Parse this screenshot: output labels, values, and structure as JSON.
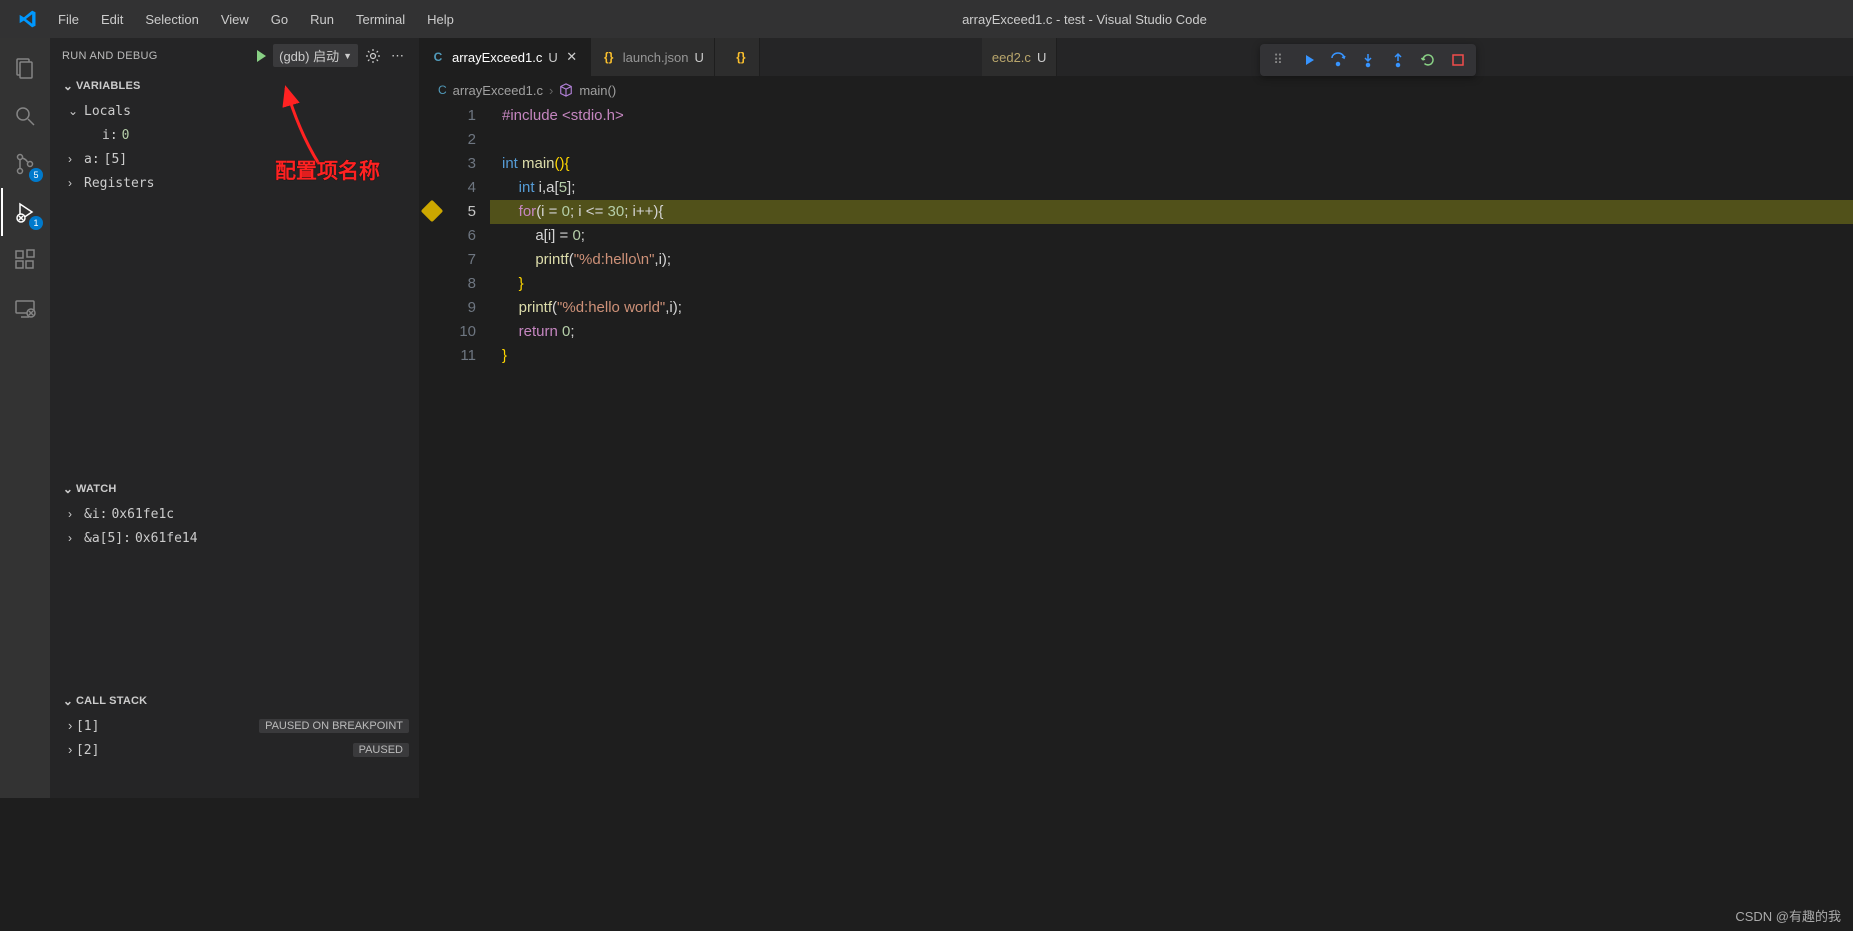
{
  "titlebar": {
    "title": "arrayExceed1.c - test - Visual Studio Code"
  },
  "menu": [
    "File",
    "Edit",
    "Selection",
    "View",
    "Go",
    "Run",
    "Terminal",
    "Help"
  ],
  "activity_badges": {
    "scm": "5",
    "debug": "1"
  },
  "sidebar": {
    "title": "RUN AND DEBUG",
    "config": "(gdb) 启动",
    "sections": {
      "variables": {
        "label": "VARIABLES",
        "locals_label": "Locals",
        "i_name": "i:",
        "i_val": "0",
        "a_name": "a:",
        "a_val": "[5]",
        "registers_label": "Registers"
      },
      "watch": {
        "label": "WATCH",
        "w1_name": "&i:",
        "w1_val": "0x61fe1c",
        "w2_name": "&a[5]:",
        "w2_val": "0x61fe14"
      },
      "callstack": {
        "label": "CALL STACK",
        "f1_name": "[1]",
        "f1_state": "PAUSED ON BREAKPOINT",
        "f2_name": "[2]",
        "f2_state": "PAUSED"
      }
    }
  },
  "tabs": {
    "t1_name": "arrayExceed1.c",
    "t1_mod": "U",
    "t2_name": "launch.json",
    "t2_mod": "U",
    "t3_name": "eed2.c",
    "t3_mod": "U"
  },
  "breadcrumb": {
    "file": "arrayExceed1.c",
    "symbol": "main()"
  },
  "code": {
    "l1": "#include <stdio.h>",
    "l3_int": "int",
    "l3_main": "main",
    "l3_rest": "(){",
    "l4_int": "int",
    "l4_rest": " i,a[",
    "l4_5": "5",
    "l4_end": "];",
    "l5_for": "for",
    "l5_a": "(i = ",
    "l5_0": "0",
    "l5_b": "; i <= ",
    "l5_30": "30",
    "l5_c": "; i++){",
    "l6_a": "a[i] = ",
    "l6_0": "0",
    "l6_b": ";",
    "l7_fn": "printf",
    "l7_a": "(",
    "l7_s": "\"%d:hello\\n\"",
    "l7_b": ",i);",
    "l8": "}",
    "l9_fn": "printf",
    "l9_a": "(",
    "l9_s": "\"%d:hello world\"",
    "l9_b": ",i);",
    "l10_ret": "return",
    "l10_sp": " ",
    "l10_0": "0",
    "l10_b": ";",
    "l11": "}"
  },
  "lines": [
    "1",
    "2",
    "3",
    "4",
    "5",
    "6",
    "7",
    "8",
    "9",
    "10",
    "11"
  ],
  "annotation": "配置项名称",
  "watermark": "CSDN @有趣的我"
}
